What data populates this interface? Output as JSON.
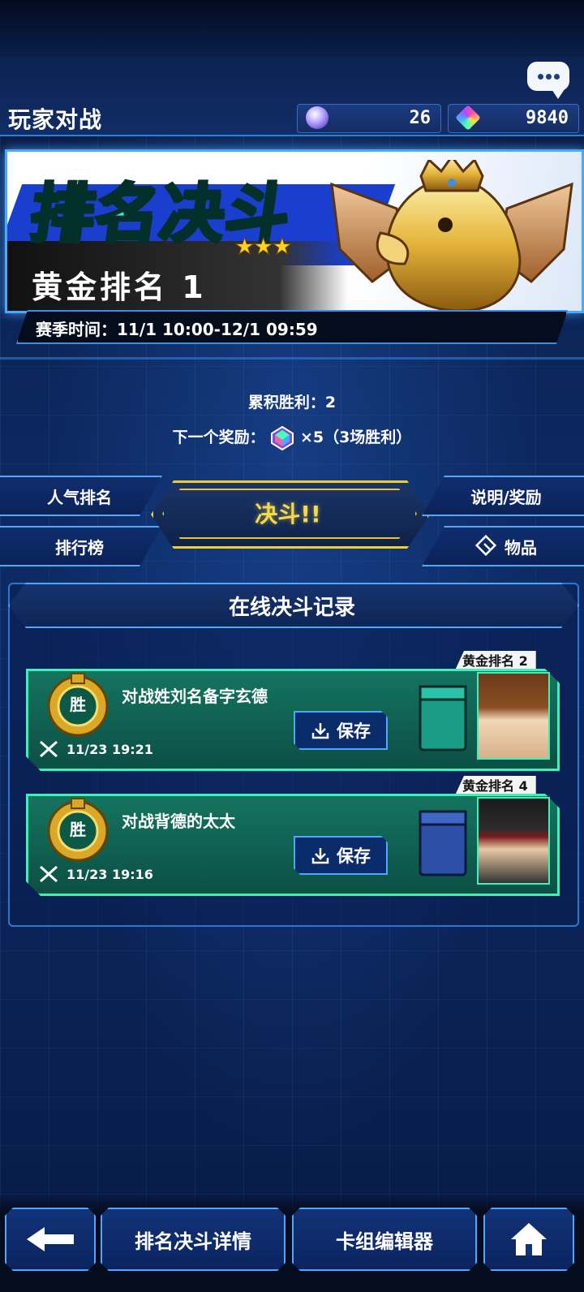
{
  "header": {
    "title": "玩家对战",
    "currency_1": {
      "icon": "orb-icon",
      "value": "26"
    },
    "currency_2": {
      "icon": "gem-icon",
      "value": "9840"
    }
  },
  "banner": {
    "title": "排名决斗",
    "stars": "★★★",
    "rank": "黄金排名 1",
    "season_label": "赛季时间：",
    "season_value": "11/1 10:00-12/1 09:59"
  },
  "stats": {
    "wins_label": "累积胜利：",
    "wins_value": "2",
    "next_reward_label": "下一个奖励：",
    "next_reward_amount": "×5（3场胜利）"
  },
  "menu": {
    "popularity": "人气排名",
    "leaderboard": "排行榜",
    "duel": "决斗!!",
    "info_rewards": "说明/奖励",
    "items": "物品"
  },
  "records": {
    "title": "在线决斗记录",
    "list": [
      {
        "rank": "黄金排名 2",
        "result": "胜",
        "opponent": "对战姓刘名备字玄德",
        "save": "保存",
        "time": "11/23 19:21",
        "deck_color": "#1a9c86"
      },
      {
        "rank": "黄金排名 4",
        "result": "胜",
        "opponent": "对战背德的太太",
        "save": "保存",
        "time": "11/23 19:16",
        "deck_color": "#2d4fa5"
      }
    ]
  },
  "bottom": {
    "back": "←",
    "ranked_details": "排名决斗详情",
    "deck_editor": "卡组编辑器",
    "home": "home-icon"
  }
}
